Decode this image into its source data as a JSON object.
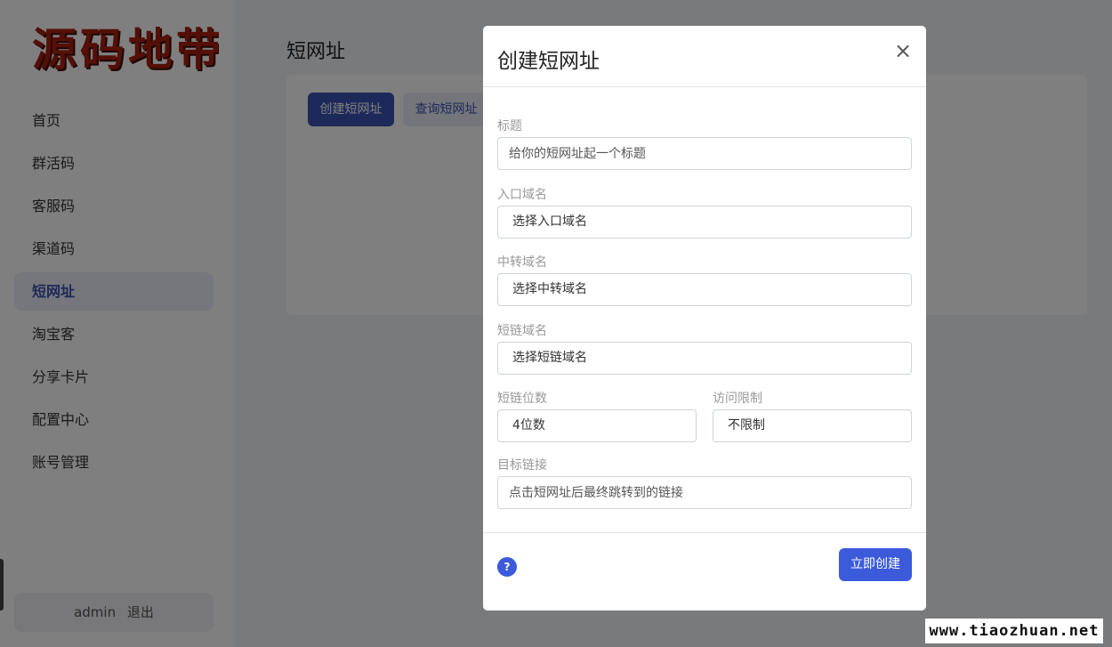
{
  "sidebar": {
    "logo_text": "源码地带",
    "items": [
      {
        "label": "首页"
      },
      {
        "label": "群活码"
      },
      {
        "label": "客服码"
      },
      {
        "label": "渠道码"
      },
      {
        "label": "短网址"
      },
      {
        "label": "淘宝客"
      },
      {
        "label": "分享卡片"
      },
      {
        "label": "配置中心"
      },
      {
        "label": "账号管理"
      }
    ],
    "active_item": "短网址",
    "user": {
      "name": "admin",
      "logout_label": "退出"
    }
  },
  "main": {
    "title": "短网址",
    "create_button": "创建短网址",
    "query_button": "查询短网址"
  },
  "modal": {
    "title": "创建短网址",
    "close_icon": "×",
    "fields": {
      "title": {
        "label": "标题",
        "placeholder": "给你的短网址起一个标题"
      },
      "entry_domain": {
        "label": "入口域名",
        "value": "选择入口域名"
      },
      "relay_domain": {
        "label": "中转域名",
        "value": "选择中转域名"
      },
      "short_domain": {
        "label": "短链域名",
        "value": "选择短链域名"
      },
      "short_length": {
        "label": "短链位数",
        "value": "4位数"
      },
      "access_limit": {
        "label": "访问限制",
        "value": "不限制"
      },
      "target_url": {
        "label": "目标链接",
        "placeholder": "点击短网址后最终跳转到的链接"
      }
    },
    "help_icon": "?",
    "submit_button": "立即创建"
  },
  "watermark": "www.tiaozhuan.net",
  "colors": {
    "primary": "#3b53b3",
    "accent": "#3b5bdb",
    "overlay": "rgba(0,0,0,0.5)"
  }
}
